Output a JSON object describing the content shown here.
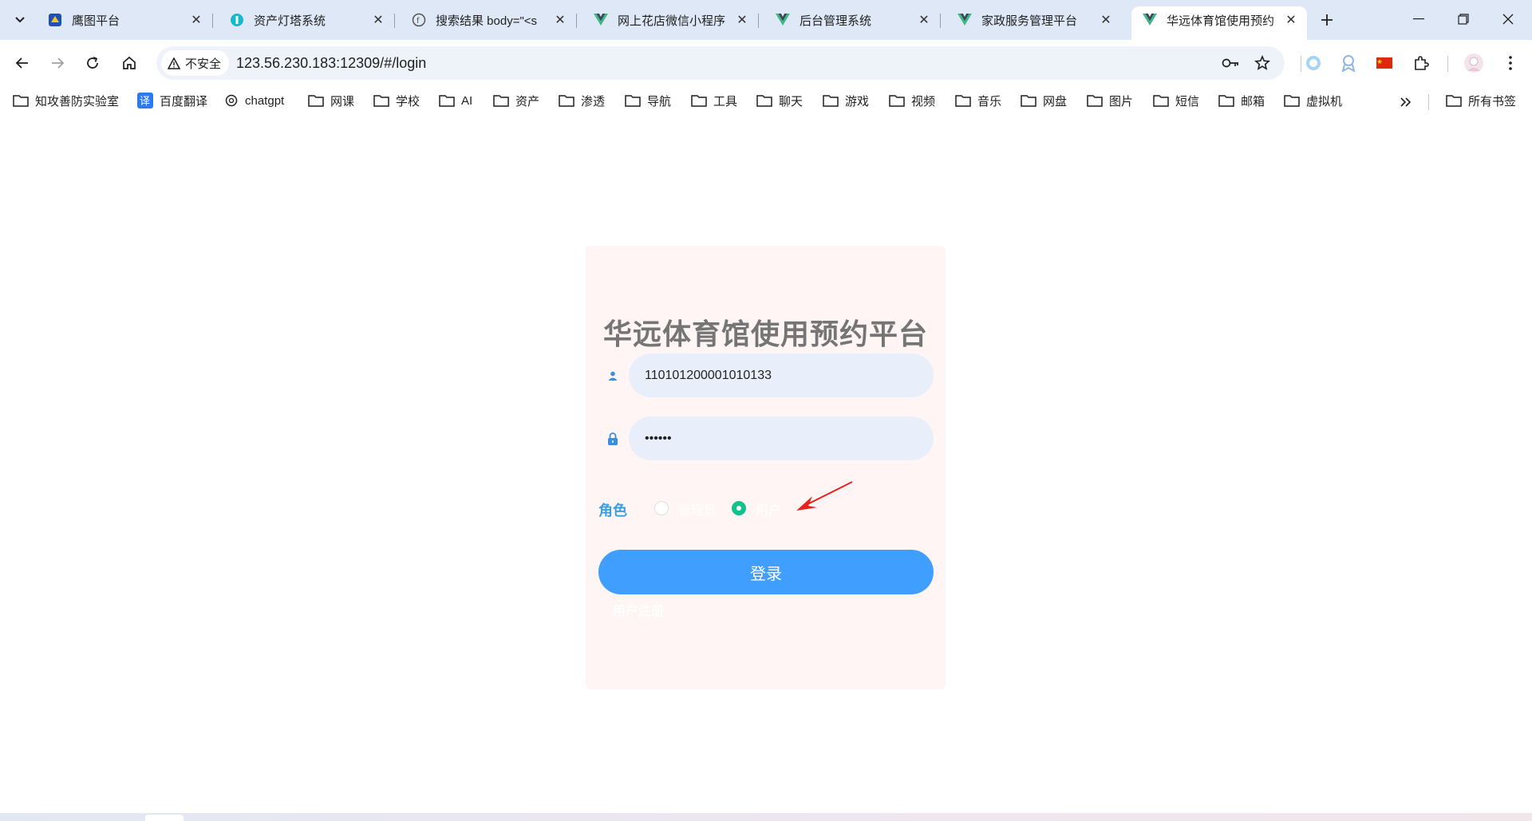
{
  "tabs": [
    {
      "title": "鹰图平台",
      "icon": "hunter-icon"
    },
    {
      "title": "资产灯塔系统",
      "icon": "lighthouse-icon"
    },
    {
      "title": "搜索结果 body=\"<s",
      "icon": "fofa-icon"
    },
    {
      "title": "网上花店微信小程序",
      "icon": "vue-icon"
    },
    {
      "title": "后台管理系统",
      "icon": "vue-icon"
    },
    {
      "title": "家政服务管理平台",
      "icon": "vue-icon"
    },
    {
      "title": "华远体育馆使用预约",
      "icon": "vue-icon",
      "active": true
    }
  ],
  "toolbar": {
    "security_label": "不安全",
    "url": "123.56.230.183:12309/#/login"
  },
  "bookmarks": [
    {
      "label": "知攻善防实验室",
      "icon": "folder-icon"
    },
    {
      "label": "百度翻译",
      "icon": "translate-icon"
    },
    {
      "label": "chatgpt",
      "icon": "openai-icon"
    },
    {
      "label": "网课",
      "icon": "folder-icon"
    },
    {
      "label": "学校",
      "icon": "folder-icon"
    },
    {
      "label": "AI",
      "icon": "folder-icon"
    },
    {
      "label": "资产",
      "icon": "folder-icon"
    },
    {
      "label": "渗透",
      "icon": "folder-icon"
    },
    {
      "label": "导航",
      "icon": "folder-icon"
    },
    {
      "label": "工具",
      "icon": "folder-icon"
    },
    {
      "label": "聊天",
      "icon": "folder-icon"
    },
    {
      "label": "游戏",
      "icon": "folder-icon"
    },
    {
      "label": "视频",
      "icon": "folder-icon"
    },
    {
      "label": "音乐",
      "icon": "folder-icon"
    },
    {
      "label": "网盘",
      "icon": "folder-icon"
    },
    {
      "label": "图片",
      "icon": "folder-icon"
    },
    {
      "label": "短信",
      "icon": "folder-icon"
    },
    {
      "label": "邮箱",
      "icon": "folder-icon"
    },
    {
      "label": "虚拟机",
      "icon": "folder-icon"
    }
  ],
  "all_bookmarks_label": "所有书签",
  "login": {
    "title": "华远体育馆使用预约平台",
    "username_value": "110101200001010133",
    "password_value": "••••••",
    "role_label": "角色",
    "roles": [
      {
        "label": "管理员",
        "selected": false
      },
      {
        "label": "用户",
        "selected": true
      }
    ],
    "login_button": "登录",
    "register_link": "用户注册"
  },
  "colors": {
    "primary_button": "#409eff",
    "radio_selected": "#13c18e",
    "card_background": "#fff5f5",
    "input_background": "#e8effb",
    "annotation_arrow": "#e8221c"
  }
}
